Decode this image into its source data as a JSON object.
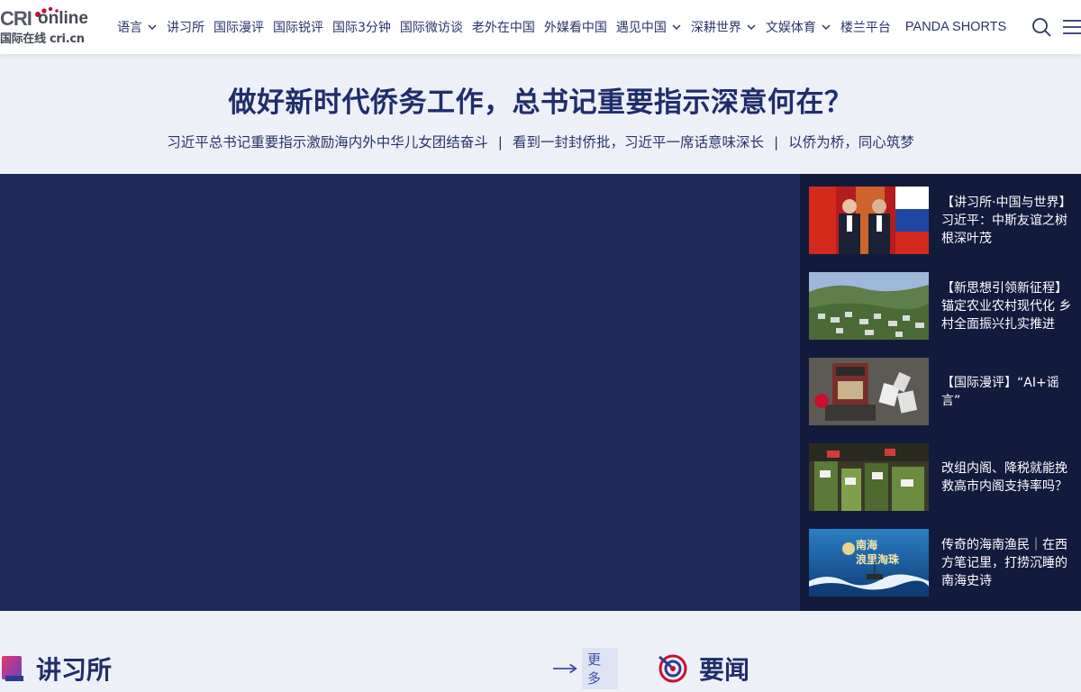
{
  "logo": {
    "brand_a": "CRI",
    "brand_b": "online",
    "sub": "国际在线 cri.cn"
  },
  "nav": [
    {
      "label": "语言",
      "dropdown": true
    },
    {
      "label": "讲习所",
      "dropdown": false
    },
    {
      "label": "国际漫评",
      "dropdown": false
    },
    {
      "label": "国际锐评",
      "dropdown": false
    },
    {
      "label": "国际3分钟",
      "dropdown": false
    },
    {
      "label": "国际微访谈",
      "dropdown": false
    },
    {
      "label": "老外在中国",
      "dropdown": false
    },
    {
      "label": "外媒看中国",
      "dropdown": false
    },
    {
      "label": "遇见中国",
      "dropdown": true
    },
    {
      "label": "深耕世界",
      "dropdown": true
    },
    {
      "label": "文娱体育",
      "dropdown": true
    },
    {
      "label": "楼兰平台",
      "dropdown": false
    },
    {
      "label": "PANDA SHORTS",
      "dropdown": false
    }
  ],
  "icons": {
    "search": "search-icon",
    "menu": "hamburger-menu-icon"
  },
  "headline": {
    "title": "做好新时代侨务工作，总书记重要指示深意何在？",
    "links": [
      "习近平总书记重要指示激励海内外中华儿女团结奋斗",
      "看到一封封侨批，习近平一席话意味深长",
      "以侨为桥，同心筑梦"
    ],
    "separator": "|"
  },
  "side_news": [
    {
      "text": "【讲习所·中国与世界】习近平：中斯友谊之树根深叶茂",
      "thumb": "photo-leaders"
    },
    {
      "text": "【新思想引领新征程】锚定农业农村现代化 乡村全面振兴扎实推进",
      "thumb": "photo-village"
    },
    {
      "text": "【国际漫评】“AI+谣言”",
      "thumb": "cartoon-ai"
    },
    {
      "text": "改组内阁、降税就能挽救高市内阁支持率吗？",
      "thumb": "photo-market"
    },
    {
      "text": "传奇的海南渔民｜在西方笔记里，打捞沉睡的南海史诗",
      "thumb": "poster-sea",
      "thumb_text": "南海\n浪里淘珠"
    }
  ],
  "sections": {
    "left": {
      "title": "讲习所",
      "more": "更多"
    },
    "right": {
      "title": "要闻"
    }
  },
  "colors": {
    "header_bg": "#ffffff",
    "page_bg": "#eef0f8",
    "video_bg": "#1e2a5a",
    "side_bg": "#131b3c",
    "title_color": "#1f2d6b",
    "accent_red": "#c8102e"
  }
}
